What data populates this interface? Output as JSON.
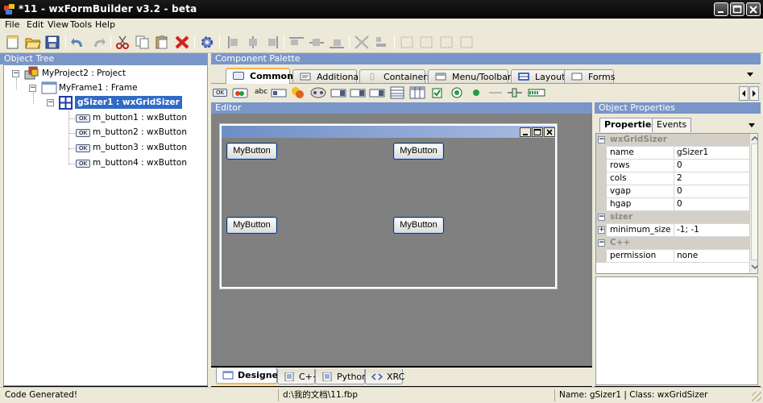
{
  "window": {
    "title": "*11 - wxFormBuilder v3.2 - beta"
  },
  "menu": [
    "File",
    "Edit",
    "View",
    "Tools",
    "Help"
  ],
  "panels": {
    "object_tree": "Object Tree",
    "palette": "Component Palette",
    "editor": "Editor",
    "properties": "Object Properties"
  },
  "tree": [
    {
      "label": "MyProject2 : Project",
      "icon": "project-icon"
    },
    {
      "label": "MyFrame1 : Frame",
      "icon": "frame-icon"
    },
    {
      "label": "gSizer1 : wxGridSizer",
      "icon": "grid-sizer-icon",
      "selected": true
    },
    {
      "label": "m_button1 : wxButton",
      "icon": "button-icon"
    },
    {
      "label": "m_button2 : wxButton",
      "icon": "button-icon"
    },
    {
      "label": "m_button3 : wxButton",
      "icon": "button-icon"
    },
    {
      "label": "m_button4 : wxButton",
      "icon": "button-icon"
    }
  ],
  "button_icon_text": "OK",
  "palette_tabs": [
    "Common",
    "Additional",
    "Containers",
    "Menu/Toolbar",
    "Layout",
    "Forms"
  ],
  "palette_items": [
    "button-icon",
    "bitmap-button-icon",
    "static-text-icon",
    "text-ctrl-icon",
    "bitmap-icon",
    "combo-box-icon",
    "choice-icon",
    "list-box-icon",
    "list-ctrl-icon",
    "grid-icon",
    "check-box-icon",
    "radio-button-icon",
    "static-line-icon",
    "slider-icon",
    "gauge-icon"
  ],
  "static_text_sample": "abc",
  "editor": {
    "buttons": [
      "MyButton",
      "MyButton",
      "MyButton",
      "MyButton"
    ]
  },
  "bottom_tabs": [
    "Designer",
    "C++",
    "Python",
    "XRC"
  ],
  "properties_tabs": [
    "Properties",
    "Events"
  ],
  "property_grid": [
    {
      "type": "category",
      "name": "wxGridSizer"
    },
    {
      "type": "prop",
      "name": "name",
      "value": "gSizer1"
    },
    {
      "type": "prop",
      "name": "rows",
      "value": "0"
    },
    {
      "type": "prop",
      "name": "cols",
      "value": "2"
    },
    {
      "type": "prop",
      "name": "vgap",
      "value": "0"
    },
    {
      "type": "prop",
      "name": "hgap",
      "value": "0"
    },
    {
      "type": "category",
      "name": "sizer"
    },
    {
      "type": "prop",
      "name": "minimum_size",
      "value": "-1; -1",
      "expandable": true
    },
    {
      "type": "category",
      "name": "C++"
    },
    {
      "type": "prop",
      "name": "permission",
      "value": "none"
    }
  ],
  "status": {
    "message": "Code Generated!",
    "file": "d:\\我的文档\\11.fbp",
    "selection": "Name: gSizer1 | Class: wxGridSizer"
  },
  "colors": {
    "panel_header": "#7a96c9",
    "selection": "#316ac5",
    "editor_bg": "#818181"
  }
}
